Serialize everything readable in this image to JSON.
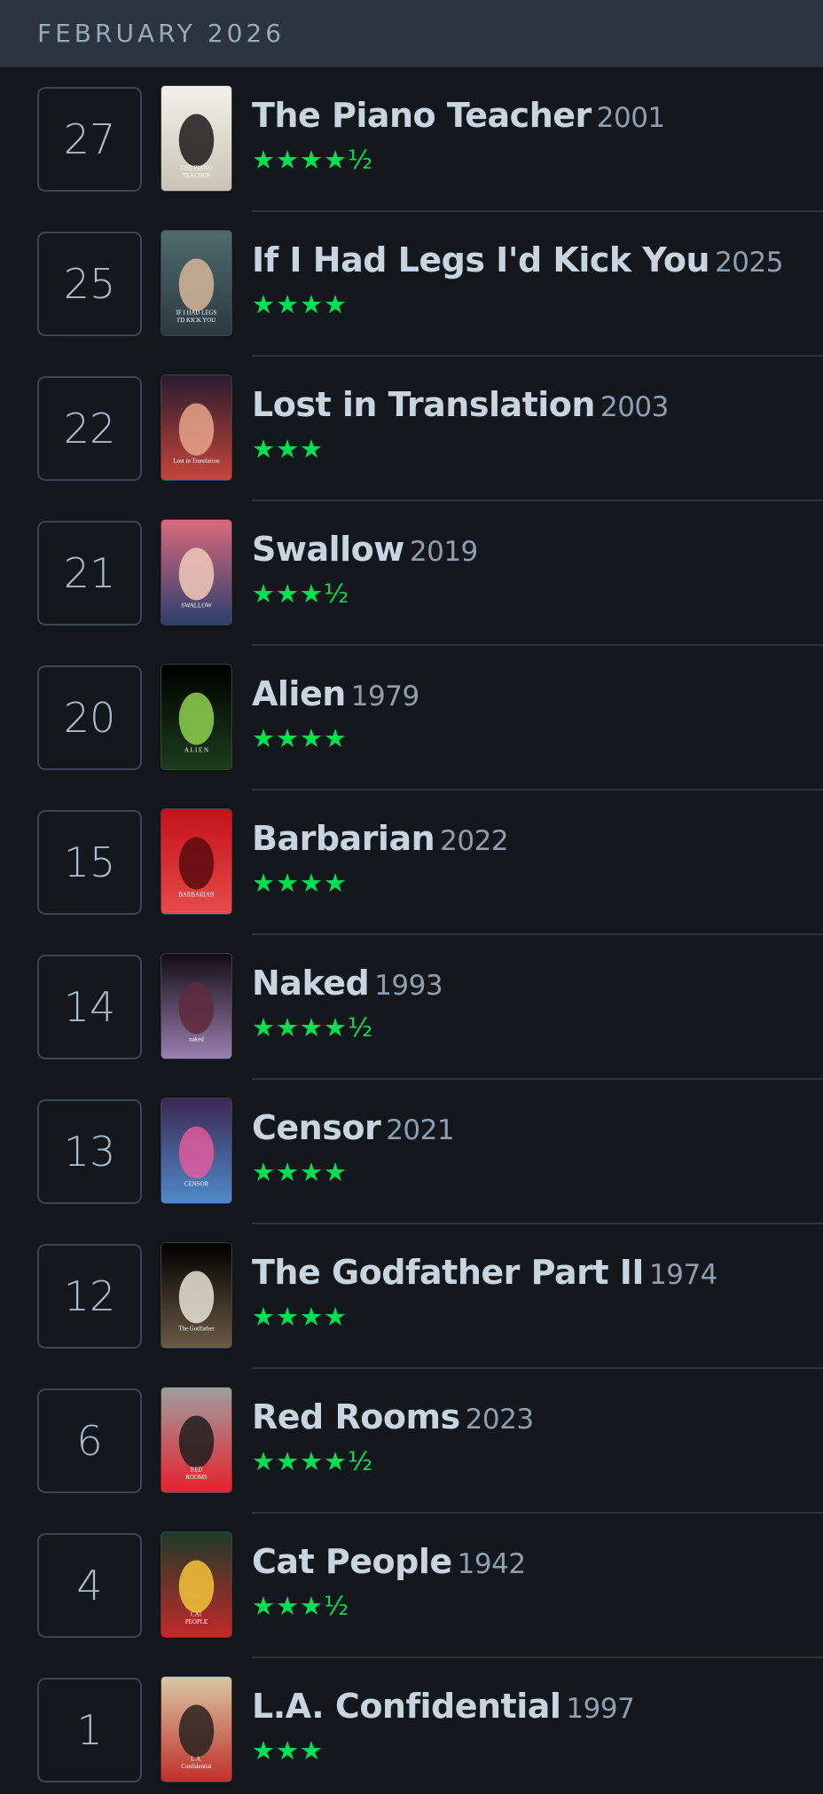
{
  "month_label": "FEBRUARY 2026",
  "accent_color": "#00e054",
  "entries": [
    {
      "day": "27",
      "title": "The Piano Teacher",
      "year": "2001",
      "rating": "★★★★½",
      "poster_text": [
        "THE PIANO",
        "TEACHER"
      ],
      "poster_colors": [
        "#f2f0ea",
        "#1b1b1b",
        "#c9c3b5"
      ]
    },
    {
      "day": "25",
      "title": "If I Had Legs I'd Kick You",
      "year": "2025",
      "rating": "★★★★",
      "poster_text": [
        "IF I HAD LEGS",
        "I'D KICK YOU"
      ],
      "poster_colors": [
        "#4f6a6e",
        "#d6b59b",
        "#2c3b3f"
      ]
    },
    {
      "day": "22",
      "title": "Lost in Translation",
      "year": "2003",
      "rating": "★★★",
      "poster_text": [
        "Lost in Translation"
      ],
      "poster_colors": [
        "#2a1d2e",
        "#e6a38a",
        "#c6453c"
      ]
    },
    {
      "day": "21",
      "title": "Swallow",
      "year": "2019",
      "rating": "★★★½",
      "poster_text": [
        "SWALLOW"
      ],
      "poster_colors": [
        "#d86a7c",
        "#f1c9b9",
        "#2e3f6e"
      ]
    },
    {
      "day": "20",
      "title": "Alien",
      "year": "1979",
      "rating": "★★★★",
      "poster_text": [
        "A L I E N"
      ],
      "poster_colors": [
        "#000000",
        "#8fd14f",
        "#1c3d1c"
      ]
    },
    {
      "day": "15",
      "title": "Barbarian",
      "year": "2022",
      "rating": "★★★★",
      "poster_text": [
        "BARBARIAN"
      ],
      "poster_colors": [
        "#c4121a",
        "#5a0a0e",
        "#e74b4b"
      ]
    },
    {
      "day": "14",
      "title": "Naked",
      "year": "1993",
      "rating": "★★★★½",
      "poster_text": [
        "naked"
      ],
      "poster_colors": [
        "#120d14",
        "#5e2a3a",
        "#9b7fb0"
      ]
    },
    {
      "day": "13",
      "title": "Censor",
      "year": "2021",
      "rating": "★★★★",
      "poster_text": [
        "CENSOR"
      ],
      "poster_colors": [
        "#3d2752",
        "#e05a9d",
        "#4f8ac8"
      ]
    },
    {
      "day": "12",
      "title": "The Godfather Part II",
      "year": "1974",
      "rating": "★★★★",
      "poster_text": [
        "The Godfather"
      ],
      "poster_colors": [
        "#000000",
        "#e8e2d6",
        "#6b5a44"
      ]
    },
    {
      "day": "6",
      "title": "Red Rooms",
      "year": "2023",
      "rating": "★★★★½",
      "poster_text": [
        "RED",
        "ROOMS"
      ],
      "poster_colors": [
        "#9e9e9e",
        "#1e1e1e",
        "#e8212d"
      ]
    },
    {
      "day": "4",
      "title": "Cat People",
      "year": "1942",
      "rating": "★★★½",
      "poster_text": [
        "CAT",
        "PEOPLE"
      ],
      "poster_colors": [
        "#1f3b2a",
        "#f2c43a",
        "#c22a2a"
      ]
    },
    {
      "day": "1",
      "title": "L.A. Confidential",
      "year": "1997",
      "rating": "★★★",
      "poster_text": [
        "L.A.",
        "Confidential"
      ],
      "poster_colors": [
        "#d9c6a5",
        "#2a2220",
        "#c0302a"
      ]
    }
  ]
}
